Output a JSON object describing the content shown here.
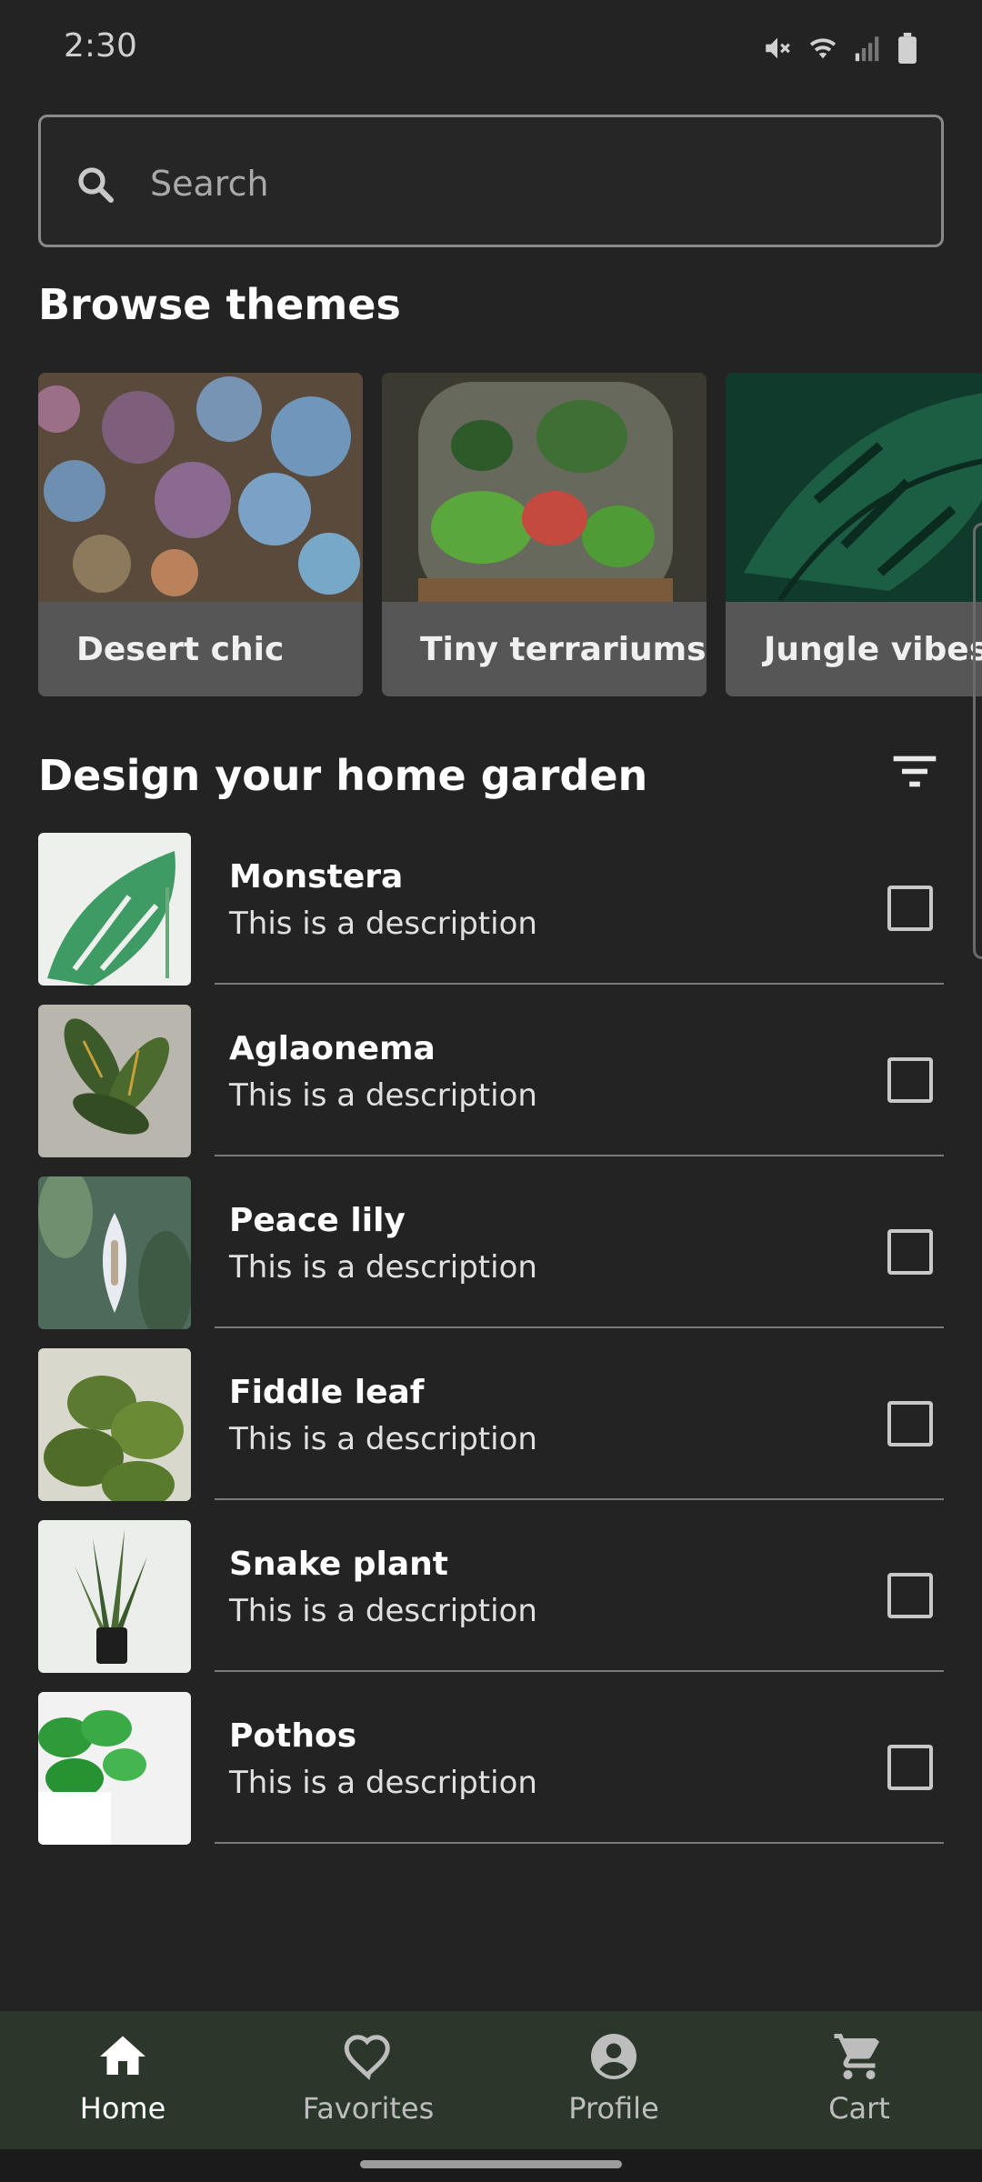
{
  "status_bar": {
    "time": "2:30",
    "icons": [
      "mute-icon",
      "wifi-icon",
      "signal-icon",
      "battery-icon"
    ]
  },
  "search": {
    "placeholder": "Search",
    "value": ""
  },
  "browse": {
    "title": "Browse themes",
    "themes": [
      {
        "label": "Desert chic",
        "image": "succulents-photo"
      },
      {
        "label": "Tiny terrariums",
        "image": "terrarium-photo"
      },
      {
        "label": "Jungle vibes",
        "image": "monstera-leaf-photo"
      }
    ]
  },
  "garden": {
    "title": "Design your home garden",
    "filter_icon": "filter-icon",
    "items": [
      {
        "name": "Monstera",
        "description": "This is a description",
        "checked": false
      },
      {
        "name": "Aglaonema",
        "description": "This is a description",
        "checked": false
      },
      {
        "name": "Peace lily",
        "description": "This is a description",
        "checked": false
      },
      {
        "name": "Fiddle leaf",
        "description": "This is a description",
        "checked": false
      },
      {
        "name": "Snake plant",
        "description": "This is a description",
        "checked": false
      },
      {
        "name": "Pothos",
        "description": "This is a description",
        "checked": false
      }
    ]
  },
  "bottom_nav": {
    "items": [
      {
        "label": "Home",
        "icon": "home-icon",
        "active": true
      },
      {
        "label": "Favorites",
        "icon": "heart-icon",
        "active": false
      },
      {
        "label": "Profile",
        "icon": "account-circle-icon",
        "active": false
      },
      {
        "label": "Cart",
        "icon": "cart-icon",
        "active": false
      }
    ]
  },
  "colors": {
    "background": "#232323",
    "nav_background": "#2c372c",
    "card_label_bg": "#565656"
  }
}
